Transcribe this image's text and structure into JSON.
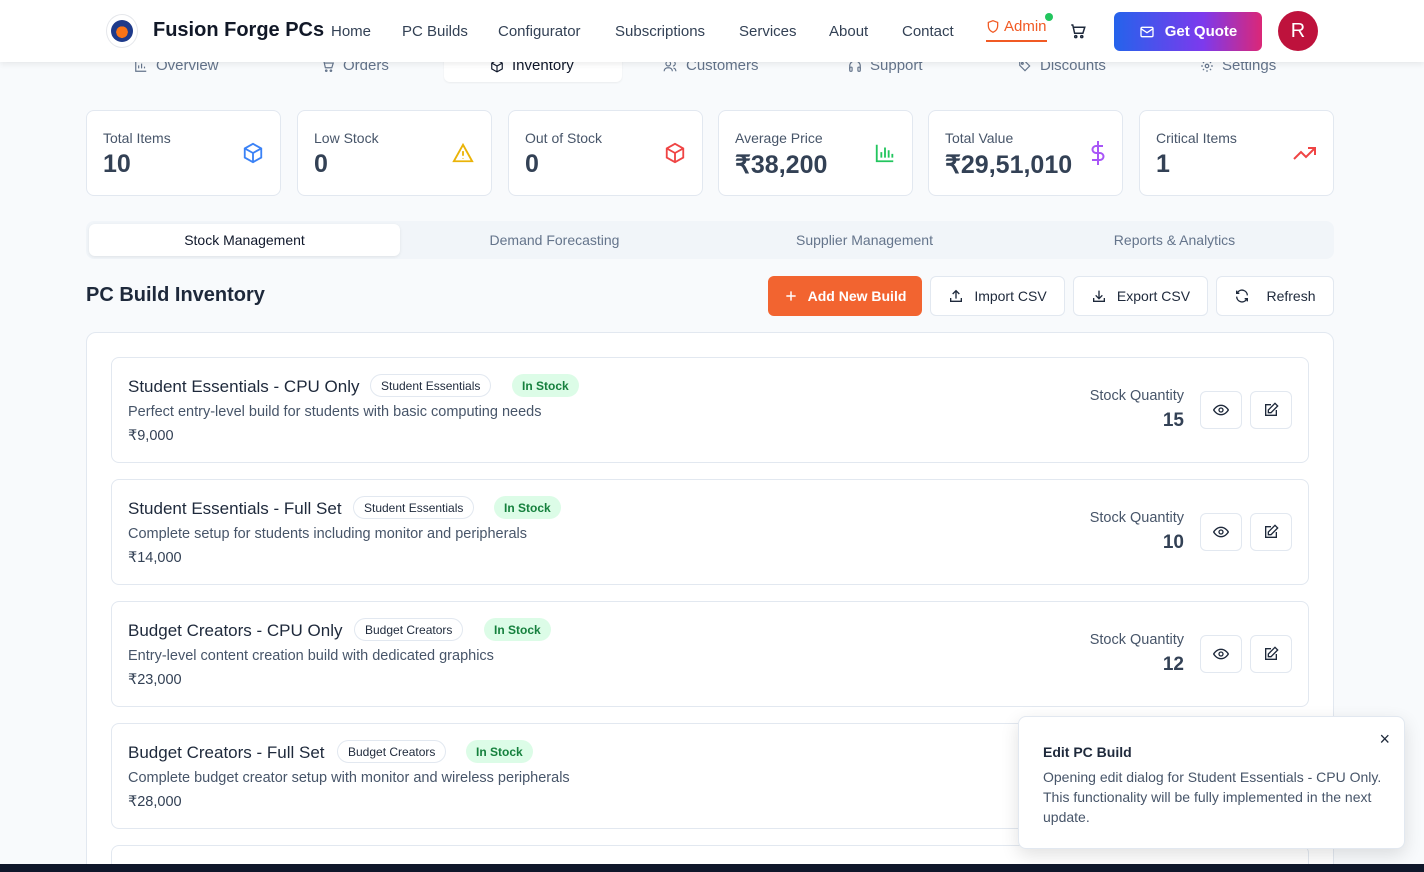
{
  "header": {
    "brand": "Fusion Forge PCs",
    "logo_text": "FusionForge PCs",
    "nav": [
      "Home",
      "PC Builds",
      "Configurator",
      "Subscriptions",
      "Services",
      "About",
      "Contact"
    ],
    "admin_label": "Admin",
    "quote_label": "Get Quote",
    "avatar_initial": "R"
  },
  "top_tabs": [
    "Overview",
    "Orders",
    "Inventory",
    "Customers",
    "Support",
    "Discounts",
    "Settings"
  ],
  "stats": [
    {
      "label": "Total Items",
      "value": "10",
      "icon": "package-icon",
      "color": "#3b82f6"
    },
    {
      "label": "Low Stock",
      "value": "0",
      "icon": "warning-icon",
      "color": "#eab308"
    },
    {
      "label": "Out of Stock",
      "value": "0",
      "icon": "package-icon",
      "color": "#ef4444"
    },
    {
      "label": "Average Price",
      "value": "₹38,200",
      "icon": "bar-chart-icon",
      "color": "#22c55e"
    },
    {
      "label": "Total Value",
      "value": "₹29,51,010",
      "icon": "dollar-icon",
      "color": "#a855f7"
    },
    {
      "label": "Critical Items",
      "value": "1",
      "icon": "trending-up-icon",
      "color": "#ef4444"
    }
  ],
  "sub_tabs": [
    "Stock Management",
    "Demand Forecasting",
    "Supplier Management",
    "Reports & Analytics"
  ],
  "inventory": {
    "title": "PC Build Inventory",
    "add_label": "Add New Build",
    "import_label": "Import CSV",
    "export_label": "Export CSV",
    "refresh_label": "Refresh",
    "qty_label": "Stock Quantity",
    "items": [
      {
        "name": "Student Essentials - CPU Only",
        "category": "Student Essentials",
        "status": "In Stock",
        "description": "Perfect entry-level build for students with basic computing needs",
        "price": "₹9,000",
        "quantity": "15"
      },
      {
        "name": "Student Essentials - Full Set",
        "category": "Student Essentials",
        "status": "In Stock",
        "description": "Complete setup for students including monitor and peripherals",
        "price": "₹14,000",
        "quantity": "10"
      },
      {
        "name": "Budget Creators - CPU Only",
        "category": "Budget Creators",
        "status": "In Stock",
        "description": "Entry-level content creation build with dedicated graphics",
        "price": "₹23,000",
        "quantity": "12"
      },
      {
        "name": "Budget Creators - Full Set",
        "category": "Budget Creators",
        "status": "In Stock",
        "description": "Complete budget creator setup with monitor and wireless peripherals",
        "price": "₹28,000",
        "quantity": ""
      }
    ]
  },
  "toast": {
    "title": "Edit PC Build",
    "message": "Opening edit dialog for Student Essentials - CPU Only. This functionality will be fully implemented in the next update.",
    "close": "×"
  }
}
